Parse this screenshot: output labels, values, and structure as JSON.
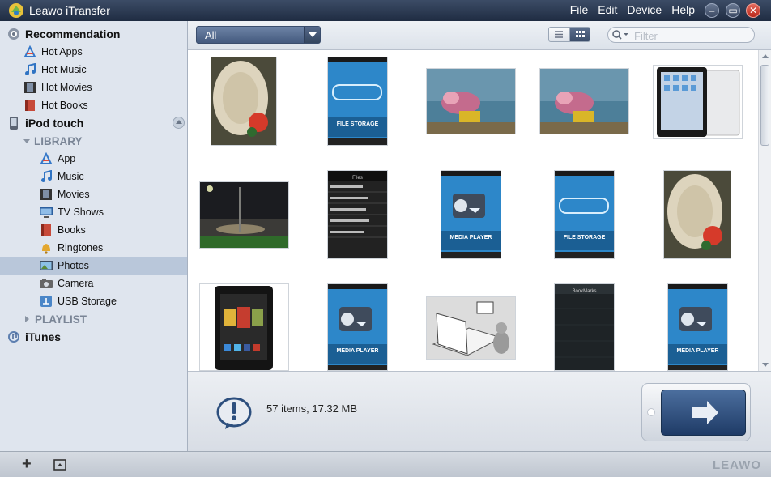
{
  "window": {
    "title": "Leawo iTransfer"
  },
  "menu": [
    "File",
    "Edit",
    "Device",
    "Help"
  ],
  "sidebar": {
    "recommendation": "Recommendation",
    "hot_apps": "Hot Apps",
    "hot_music": "Hot Music",
    "hot_movies": "Hot Movies",
    "hot_books": "Hot Books",
    "device": "iPod touch",
    "library": "LIBRARY",
    "app": "App",
    "music": "Music",
    "movies": "Movies",
    "tv_shows": "TV Shows",
    "books": "Books",
    "ringtones": "Ringtones",
    "photos": "Photos",
    "camera": "Camera",
    "usb_storage": "USB Storage",
    "playlist": "PLAYLIST",
    "itunes": "iTunes",
    "selected": "Photos"
  },
  "toolbar": {
    "filter_value": "All",
    "search_placeholder": "Filter"
  },
  "thumbnails": [
    {
      "kind": "hat-flowers"
    },
    {
      "kind": "file-storage-screen",
      "caption": "FILE STORAGE"
    },
    {
      "kind": "flower-vase"
    },
    {
      "kind": "flower-vase"
    },
    {
      "kind": "ipad-devices"
    },
    {
      "kind": "night-street"
    },
    {
      "kind": "files-list-screen",
      "caption": "Files"
    },
    {
      "kind": "media-player-screen",
      "caption": "MEDIA PLAYER"
    },
    {
      "kind": "file-storage-screen",
      "caption": "FILE STORAGE"
    },
    {
      "kind": "hat-flowers"
    },
    {
      "kind": "kindle-tablet"
    },
    {
      "kind": "media-player-screen",
      "caption": "MEDIA PLAYER"
    },
    {
      "kind": "book-sketch"
    },
    {
      "kind": "bookmarks-screen",
      "caption": "BookMarks"
    },
    {
      "kind": "media-player-screen",
      "caption": "MEDIA PLAYER"
    }
  ],
  "status": {
    "summary": "57 items, 17.32 MB"
  },
  "brand": "LEAWO",
  "colors": {
    "selected_row": "#b9c7da",
    "sidebar_bg": "#dfe5ee",
    "title_bar": "#2b3a54",
    "transfer_button": "#2f4e7d"
  }
}
